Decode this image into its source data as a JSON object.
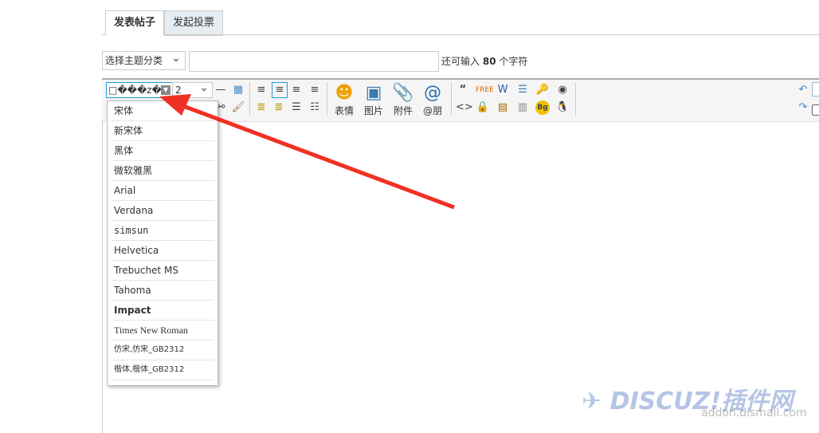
{
  "tabs": [
    {
      "label": "发表帖子",
      "active": true
    },
    {
      "label": "发起投票",
      "active": false
    }
  ],
  "category_select": {
    "value": "选择主题分类"
  },
  "subject_input": {
    "value": "",
    "placeholder": ""
  },
  "char_hint": {
    "prefix": "还可输入",
    "count": "80",
    "suffix": "个字符"
  },
  "toolbar": {
    "font_select": "□���z�",
    "size_select": "2",
    "big_buttons": [
      {
        "icon": "smiley-icon",
        "label": "表情"
      },
      {
        "icon": "image-icon",
        "label": "图片"
      },
      {
        "icon": "paperclip-icon",
        "label": "附件"
      },
      {
        "icon": "at-icon",
        "label": "@朋"
      }
    ]
  },
  "font_menu": [
    "宋体",
    "新宋体",
    "黑体",
    "微软雅黑",
    "Arial",
    "Verdana",
    "simsun",
    "Helvetica",
    "Trebuchet MS",
    "Tahoma",
    "Impact",
    "Times New Roman",
    "仿宋,仿宋_GB2312",
    "楷体,楷体_GB2312"
  ],
  "watermark": {
    "logo": "DISCUZ!插件网",
    "url": "addon.dismall.com"
  },
  "colors": {
    "accent": "#1e9bd6",
    "arrow": "#f03024"
  }
}
